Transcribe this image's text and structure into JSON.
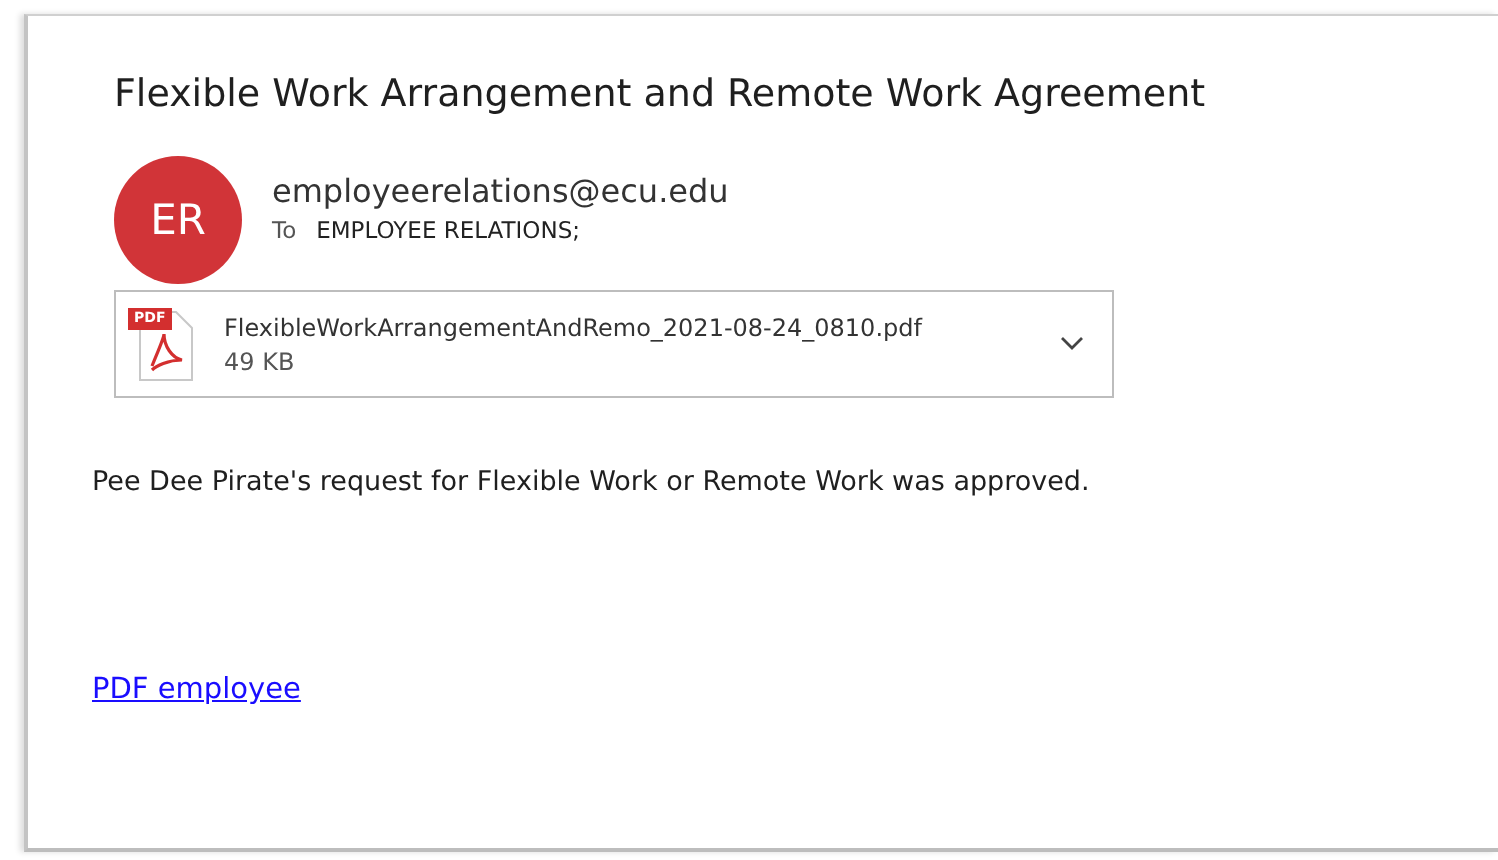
{
  "subject": "Flexible Work Arrangement and Remote Work Agreement",
  "sender": {
    "initials": "ER",
    "email": "employeerelations@ecu.edu",
    "to_label": "To",
    "to": "EMPLOYEE RELATIONS;"
  },
  "attachment": {
    "badge": "PDF",
    "name": "FlexibleWorkArrangementAndRemo_2021-08-24_0810.pdf",
    "size": "49 KB"
  },
  "body": "Pee Dee Pirate's request for Flexible Work or Remote Work was approved.",
  "link": "PDF employee"
}
